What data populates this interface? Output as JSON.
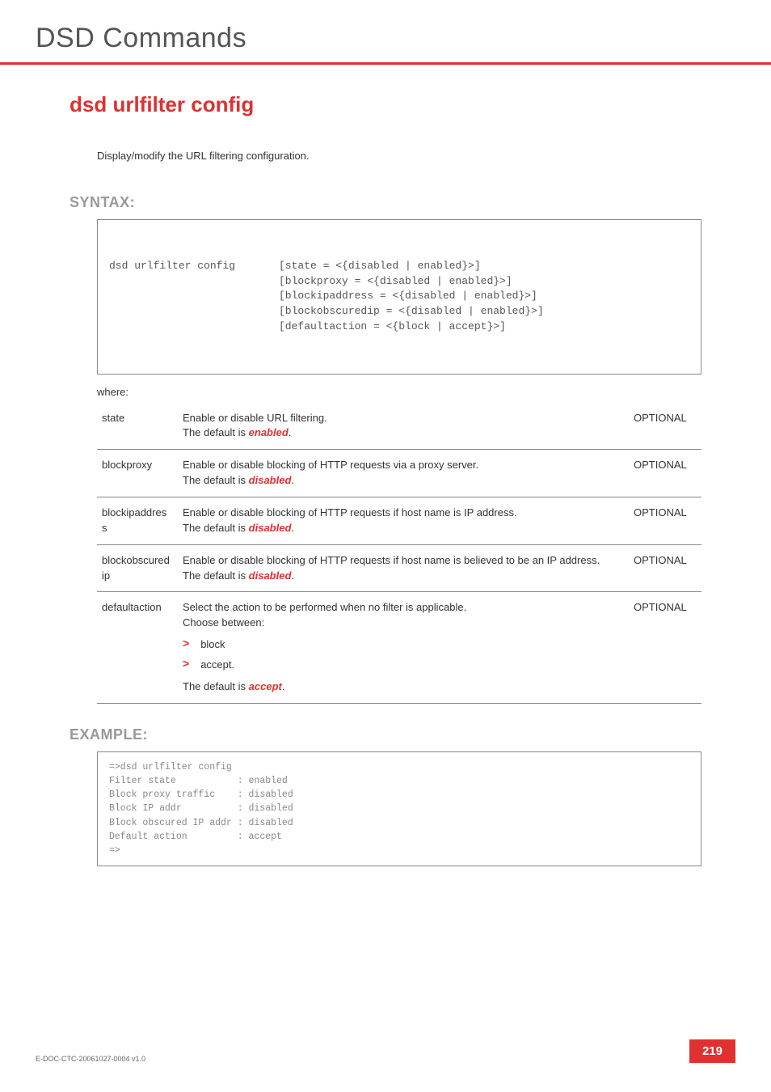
{
  "header": {
    "chapter": "DSD Commands"
  },
  "command": {
    "title": "dsd urlfilter config",
    "description": "Display/modify the URL filtering configuration."
  },
  "syntax": {
    "label": "SYNTAX:",
    "cmd": "dsd urlfilter config",
    "args": "[state = <{disabled | enabled}>]\n[blockproxy = <{disabled | enabled}>]\n[blockipaddress = <{disabled | enabled}>]\n[blockobscuredip = <{disabled | enabled}>]\n[defaultaction = <{block | accept}>]",
    "where": "where:"
  },
  "params": [
    {
      "name": "state",
      "desc_pre": "Enable or disable URL filtering.\nThe default is ",
      "default": "enabled",
      "desc_post": ".",
      "opt": "OPTIONAL"
    },
    {
      "name": "blockproxy",
      "desc_pre": "Enable or disable blocking of HTTP requests via a proxy server.\nThe default is ",
      "default": "disabled",
      "desc_post": ".",
      "opt": "OPTIONAL"
    },
    {
      "name": "blockipaddress",
      "desc_pre": "Enable or disable blocking of HTTP requests if host name is IP address.\nThe default is ",
      "default": "disabled",
      "desc_post": ".",
      "opt": "OPTIONAL"
    },
    {
      "name": "blockobscuredip",
      "desc_pre": "Enable or disable blocking of  HTTP requests if host name is believed to be an IP address.\nThe default is ",
      "default": "disabled",
      "desc_post": ".",
      "opt": "OPTIONAL"
    },
    {
      "name": "defaultaction",
      "desc_pre": "Select the action to be performed when no filter is applicable.\nChoose between:",
      "bullets": [
        "block",
        "accept."
      ],
      "after_pre": "The default is ",
      "default": "accept",
      "after_post": ".",
      "opt": "OPTIONAL"
    }
  ],
  "example": {
    "label": "EXAMPLE:",
    "text": "=>dsd urlfilter config\nFilter state           : enabled\nBlock proxy traffic    : disabled\nBlock IP addr          : disabled\nBlock obscured IP addr : disabled\nDefault action         : accept\n=>"
  },
  "footer": {
    "doc_id": "E-DOC-CTC-20061027-0004 v1.0",
    "page": "219"
  }
}
